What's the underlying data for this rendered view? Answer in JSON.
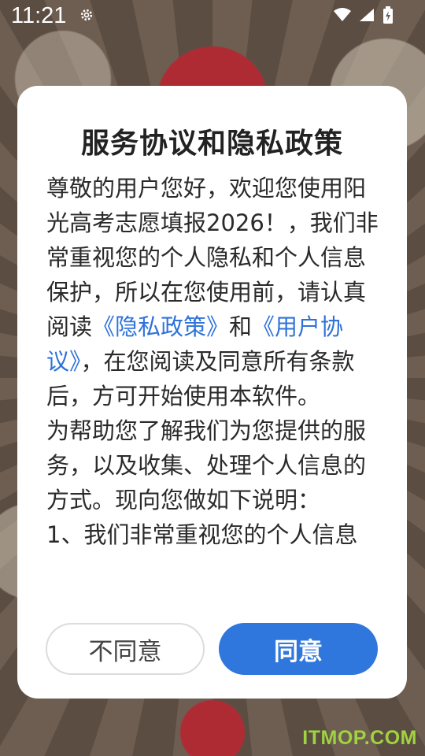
{
  "status_bar": {
    "time": "11:21",
    "icons": [
      "settings-icon",
      "wifi-icon",
      "cellular-icon",
      "battery-charging-icon"
    ]
  },
  "dialog": {
    "title": "服务协议和隐私政策",
    "paragraph1_part1": "尊敬的用户您好，欢迎您使用阳光高考志愿填报2026！，我们非常重视您的个人隐私和个人信息保护，所以在您使用前，请认真阅读",
    "privacy_link": "《隐私政策》",
    "paragraph1_part2": "和",
    "user_agreement_link": "《用户协议》",
    "paragraph1_part3": "，在您阅读及同意所有条款后，方可开始使用本软件。",
    "paragraph2": "为帮助您了解我们为您提供的服务，以及收集、处理个人信息的方式。现向您做如下说明：",
    "paragraph3_partial": "1、我们非常重视您的个人信息",
    "disagree_label": "不同意",
    "agree_label": "同意"
  },
  "watermark": "ITMOP.COM",
  "colors": {
    "accent": "#2f76dd",
    "link": "#2f73d9",
    "watermark": "#9fd33f"
  }
}
